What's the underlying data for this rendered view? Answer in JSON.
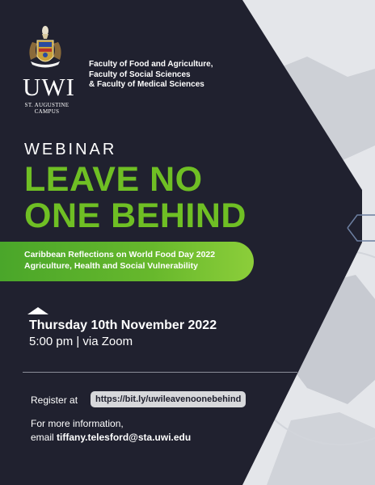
{
  "logo": {
    "name": "UWI",
    "campus_line1": "ST. AUGUSTINE",
    "campus_line2": "CAMPUS"
  },
  "faculties": [
    "Faculty of Food and Agriculture,",
    "Faculty of Social Sciences",
    "& Faculty of Medical Sciences"
  ],
  "event": {
    "type": "WEBINAR",
    "title_line1": "LEAVE NO",
    "title_line2": "ONE BEHIND",
    "subtitle_line1": "Caribbean Reflections on World Food Day 2022",
    "subtitle_line2": "Agriculture, Health and Social Vulnerability",
    "date": "Thursday 10th November 2022",
    "time": "5:00 pm | via Zoom"
  },
  "register": {
    "label": "Register at",
    "link": "https://bit.ly/uwileavenoonebehind"
  },
  "info": {
    "line1": "For more information,",
    "email_prefix": "email",
    "email": "tiffany.telesford@sta.uwi.edu"
  },
  "colors": {
    "dark_panel": "#20212f",
    "accent_green": "#6fbf24",
    "light_bg": "#dfe2e7"
  }
}
